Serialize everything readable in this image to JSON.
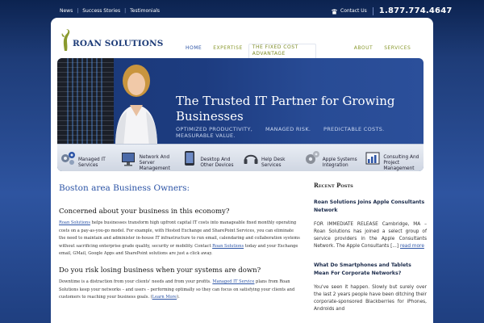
{
  "topbar": {
    "links": [
      "News",
      "Success Stories",
      "Testimonials"
    ],
    "contact_label": "Contact Us",
    "phone": "1.877.774.4647"
  },
  "logo": {
    "text": "ROAN SOLUTIONS"
  },
  "nav": {
    "items": [
      "HOME",
      "EXPERTISE",
      "THE FIXED COST ADVANTAGE",
      "ABOUT",
      "SERVICES"
    ]
  },
  "hero": {
    "title": "The Trusted IT Partner for Growing Businesses",
    "taglines": [
      "OPTIMIZED PRODUCTIVITY, MEASURABLE VALUE.",
      "MANAGED RISK.",
      "PREDICTABLE COSTS."
    ]
  },
  "services": [
    {
      "label": "Managed IT Services",
      "icon": "gears-icon"
    },
    {
      "label": "Network And Server Management",
      "icon": "monitor-icon"
    },
    {
      "label": "Desktop And Other Devices",
      "icon": "tablet-icon"
    },
    {
      "label": "Help Desk Services",
      "icon": "headset-icon"
    },
    {
      "label": "Apple Systems Integration",
      "icon": "cogs-icon"
    },
    {
      "label": "Consulting And Project Management",
      "icon": "chart-icon"
    }
  ],
  "main": {
    "intro": "Boston area Business Owners:",
    "section1": {
      "heading": "Concerned about your business in this economy?",
      "link1": "Roan Solutions",
      "body1": " helps businesses transform high upfront capital IT costs into manageable fixed monthly operating costs on a pay-as-you-go model. For example, with Hosted Exchange and SharePoint Services, you can eliminate the need to maintain and administer in-house IT infrastructure to run email, calendaring and collaboration systems without sacrificing enterprise grade quality, security or mobility. Contact ",
      "link2": "Roan Solutions",
      "body2": " today and your Exchange email, GMail, Google Apps and SharePoint solutions are just a click away."
    },
    "section2": {
      "heading": "Do you risk losing business when your systems are down?",
      "body1": "Downtime is a distraction from your clients' needs and from your profits. ",
      "link1": "Managed IT Service",
      "body2": " plans from Roan Solutions keep your networks – and users – performing optimally so they can focus on satisfying your clients and customers to reaching your business goals. (",
      "link2": "Learn More",
      "body3": ")."
    }
  },
  "sidebar": {
    "title": "Recent Posts",
    "post1": {
      "title": "Roan Solutions Joins Apple Consultants Network",
      "text": "FOR IMMEDIATE RELEASE   Cambridge, MA – Roan Solutions has joined a select group of service providers in the Apple Consultants Network. The Apple Consultants [...] ",
      "more": "read more"
    },
    "post2": {
      "title": "What Do Smartphones and Tablets Mean For Corporate Networks?",
      "text": "You've seen it happen. Slowly but surely over the last 2 years people have been ditching their corporate-sponsored Blackberries for iPhones, Androids and"
    }
  },
  "colors": {
    "accent": "#2c54a6",
    "nav_green": "#8a9a2e",
    "background": "#1e3c78"
  }
}
